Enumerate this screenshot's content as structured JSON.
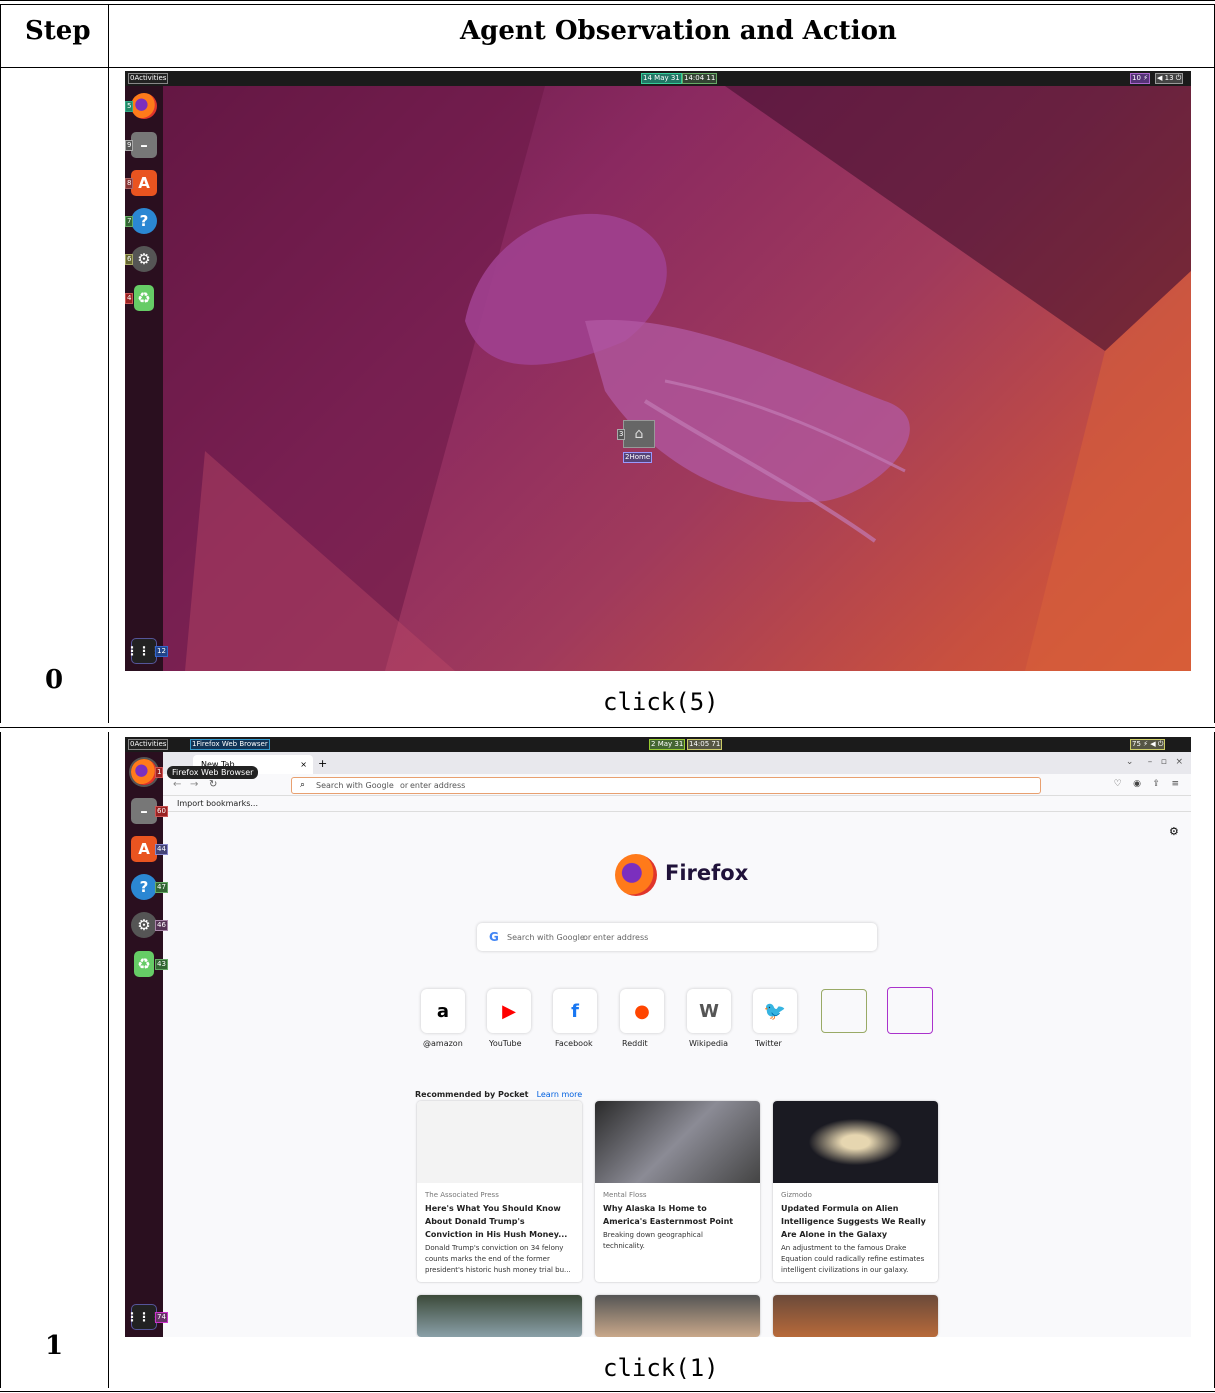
{
  "table": {
    "header_step": "Step",
    "header_obs": "Agent Observation and Action"
  },
  "rows": [
    {
      "step": "0",
      "action": "click(5)",
      "topbar": {
        "activities": "Activities",
        "date": "May 31",
        "time": "14:04",
        "tray": "",
        "num_activities": "0",
        "num_date": "14",
        "num_time": "11",
        "num_tray_left": "10",
        "num_tray_right": "13"
      },
      "dock_numbers": [
        "5",
        "9",
        "8",
        "7",
        "6",
        "4"
      ],
      "dock_grid_number": "12",
      "home_label": "Home",
      "home_num": "2",
      "home_icon_num": "3"
    },
    {
      "step": "1",
      "action": "click(1)",
      "topbar": {
        "activities": "Activities",
        "app": "Firefox Web Browser",
        "date": "May 31",
        "time": "14:05",
        "num_activities": "0",
        "num_app": "1",
        "num_date": "2",
        "num_time": "71",
        "num_tray": "75"
      },
      "tooltip": "Firefox Web Browser",
      "tab_label": "New Tab",
      "toolbar": {
        "search_placeholder": "Search with Google",
        "or": "or",
        "enter_address": "enter address",
        "import_bookmarks": "Import bookmarks..."
      },
      "firefox_wordmark": "Firefox",
      "search_box": {
        "text": "Search with Google",
        "or": "or",
        "enter_address": "enter address"
      },
      "shortcuts": [
        {
          "label": "@amazon",
          "glyph": "a",
          "color": "#000000"
        },
        {
          "label": "YouTube",
          "glyph": "▶",
          "color": "#ff0000"
        },
        {
          "label": "Facebook",
          "glyph": "f",
          "color": "#1877f2"
        },
        {
          "label": "Reddit",
          "glyph": "●",
          "color": "#ff4500"
        },
        {
          "label": "Wikipedia",
          "glyph": "W",
          "color": "#555555"
        },
        {
          "label": "Twitter",
          "glyph": "🐦",
          "color": "#1da1f2"
        }
      ],
      "pocket": {
        "heading": "Recommended by Pocket",
        "learn_more": "Learn more"
      },
      "articles": [
        {
          "source": "The Associated Press",
          "title_lines": [
            "Here's What You Should Know",
            "About Donald Trump's",
            "Conviction in His Hush Money..."
          ],
          "excerpt_lines": [
            "Donald Trump's conviction on 34 felony",
            "counts marks the end of the former",
            "president's historic hush money trial bu..."
          ]
        },
        {
          "source": "Mental Floss",
          "title_lines": [
            "Why Alaska Is Home to",
            "America's Easternmost Point"
          ],
          "excerpt_lines": [
            "Breaking down geographical",
            "technicality."
          ]
        },
        {
          "source": "Gizmodo",
          "title_lines": [
            "Updated Formula on Alien",
            "Intelligence Suggests We Really",
            "Are Alone in the Galaxy"
          ],
          "excerpt_lines": [
            "An adjustment to the famous Drake",
            "Equation could radically refine estimates",
            "intelligent civilizations in our galaxy."
          ]
        }
      ],
      "dock_numbers": [
        "1",
        "60",
        "44",
        "47",
        "46",
        "43"
      ],
      "dock_grid_number": "74"
    }
  ],
  "colors": {
    "desktop_bg": "#7a1f4f",
    "topbar": "#1b1b1b",
    "dock": "#2a0f1f",
    "browser_bg": "#f9f9fb"
  }
}
